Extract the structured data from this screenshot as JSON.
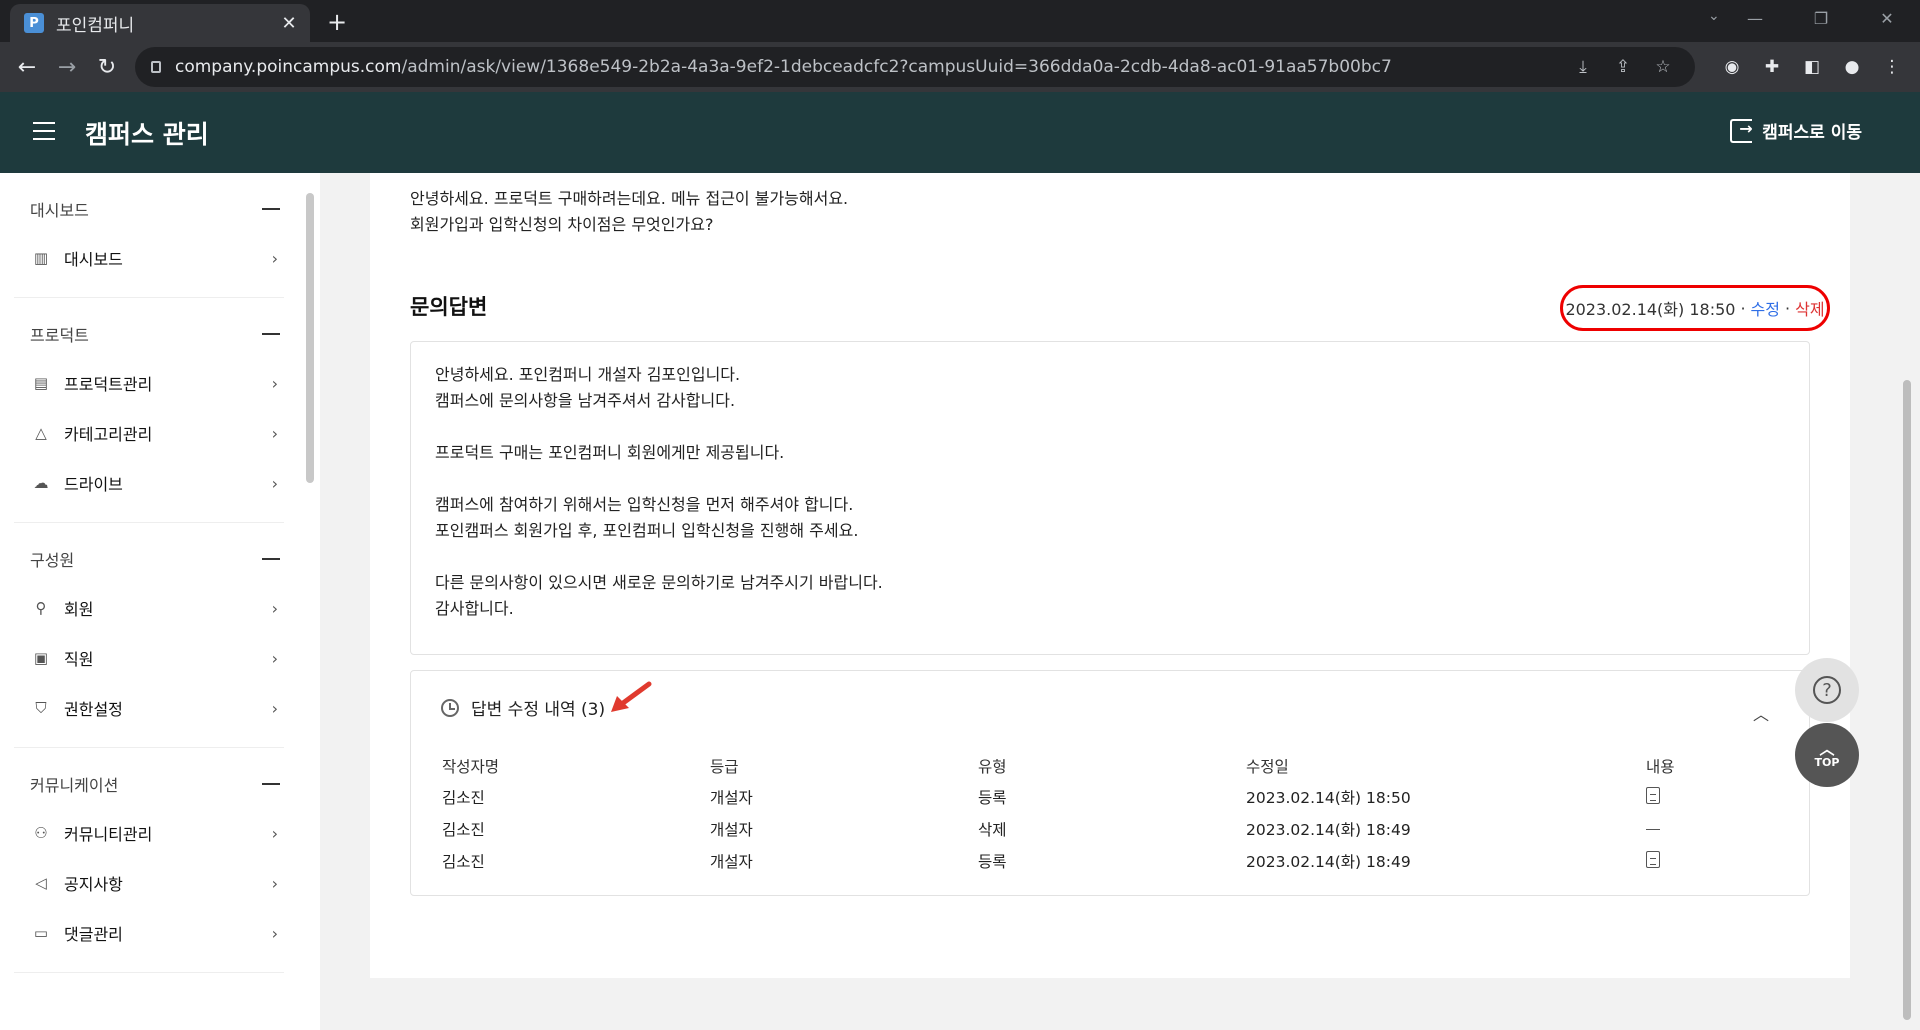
{
  "browser": {
    "tab_title": "포인컴퍼니",
    "tab_favicon": "P",
    "url_host": "company.poincampus.com",
    "url_path": "/admin/ask/view/1368e549-2b2a-4a3a-9ef2-1debceadcfc2?campusUuid=366dda0a-2cdb-4da8-ac01-91aa57b00bc7"
  },
  "header": {
    "title": "캠퍼스 관리",
    "goto_campus": "캠퍼스로 이동"
  },
  "sidebar": {
    "groups": [
      {
        "label": "대시보드",
        "items": [
          {
            "label": "대시보드",
            "icon": "bar-chart-icon"
          }
        ]
      },
      {
        "label": "프로덕트",
        "items": [
          {
            "label": "프로덕트관리",
            "icon": "product-icon"
          },
          {
            "label": "카테고리관리",
            "icon": "category-icon"
          },
          {
            "label": "드라이브",
            "icon": "cloud-icon"
          }
        ]
      },
      {
        "label": "구성원",
        "items": [
          {
            "label": "회원",
            "icon": "member-search-icon"
          },
          {
            "label": "직원",
            "icon": "staff-badge-icon"
          },
          {
            "label": "권한설정",
            "icon": "shield-icon"
          }
        ]
      },
      {
        "label": "커뮤니케이션",
        "items": [
          {
            "label": "커뮤니티관리",
            "icon": "community-icon"
          },
          {
            "label": "공지사항",
            "icon": "megaphone-icon"
          },
          {
            "label": "댓글관리",
            "icon": "comment-icon"
          }
        ]
      }
    ]
  },
  "question": {
    "lines": [
      "안녕하세요. 프로덕트 구매하려는데요. 메뉴 접근이 불가능해서요.",
      "회원가입과 입학신청의 차이점은 무엇인가요?"
    ]
  },
  "answer": {
    "title": "문의답변",
    "date": "2023.02.14(화) 18:50",
    "edit_label": "수정",
    "delete_label": "삭제",
    "separator": "·",
    "paragraphs": [
      [
        "안녕하세요. 포인컴퍼니 개설자 김포인입니다.",
        "캠퍼스에 문의사항을 남겨주셔서 감사합니다."
      ],
      [
        "프로덕트 구매는 포인컴퍼니 회원에게만 제공됩니다."
      ],
      [
        "캠퍼스에 참여하기 위해서는 입학신청을 먼저 해주셔야 합니다.",
        "포인캠퍼스 회원가입 후, 포인컴퍼니 입학신청을 진행해 주세요."
      ],
      [
        "다른 문의사항이 있으시면 새로운 문의하기로 남겨주시기 바랍니다.",
        "감사합니다."
      ]
    ]
  },
  "history": {
    "title": "답변 수정 내역 (3)",
    "columns": [
      "작성자명",
      "등급",
      "유형",
      "수정일",
      "내용"
    ],
    "rows": [
      {
        "author": "김소진",
        "grade": "개설자",
        "type": "등록",
        "date": "2023.02.14(화) 18:50",
        "content": "document"
      },
      {
        "author": "김소진",
        "grade": "개설자",
        "type": "삭제",
        "date": "2023.02.14(화) 18:49",
        "content": "none"
      },
      {
        "author": "김소진",
        "grade": "개설자",
        "type": "등록",
        "date": "2023.02.14(화) 18:49",
        "content": "document"
      }
    ]
  },
  "fab": {
    "top_label": "TOP"
  },
  "colors": {
    "header_bg": "#1e3a3d",
    "annotation_red": "#e00000",
    "link_blue": "#2f6ee6"
  }
}
